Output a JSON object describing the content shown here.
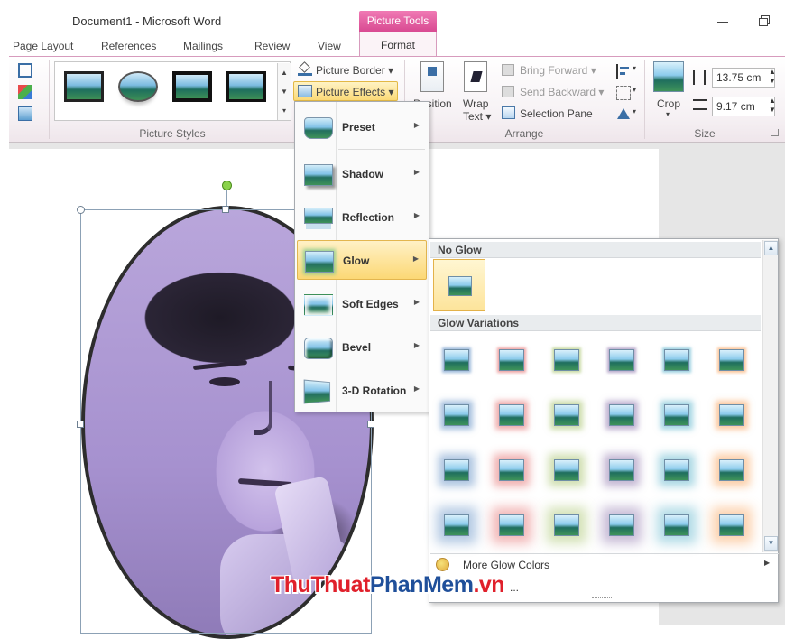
{
  "window": {
    "title": "Document1  -  Microsoft Word",
    "contextual_tab_group": "Picture Tools"
  },
  "tabs": [
    {
      "label": "Page Layout"
    },
    {
      "label": "References"
    },
    {
      "label": "Mailings"
    },
    {
      "label": "Review"
    },
    {
      "label": "View"
    },
    {
      "label": "Format",
      "active": true
    }
  ],
  "ribbon": {
    "picture_border": "Picture Border",
    "picture_effects": "Picture Effects",
    "picture_styles_label": "Picture Styles",
    "position": "Position",
    "wrap_text_line1": "Wrap",
    "wrap_text_line2": "Text",
    "bring_forward": "Bring Forward",
    "send_backward": "Send Backward",
    "selection_pane": "Selection Pane",
    "arrange_label": "Arrange",
    "crop": "Crop",
    "height": "13.75 cm",
    "width": "9.17 cm",
    "size_label": "Size"
  },
  "effects_menu": {
    "items": [
      {
        "label": "Preset"
      },
      {
        "label": "Shadow"
      },
      {
        "label": "Reflection"
      },
      {
        "label": "Glow",
        "selected": true
      },
      {
        "label": "Soft Edges"
      },
      {
        "label": "Bevel"
      },
      {
        "label": "3-D Rotation"
      }
    ]
  },
  "glow_panel": {
    "no_glow_header": "No Glow",
    "variations_header": "Glow Variations",
    "more_colors": "More Glow Colors",
    "options_partial": "...",
    "colors": [
      "#4f81bd",
      "#e05a5a",
      "#9bbb59",
      "#8064a2",
      "#4bacc6",
      "#f79646"
    ],
    "rows": 4
  },
  "watermark": {
    "part1": "ThuThuat",
    "part2": "PhanMem",
    "part3": ".vn"
  }
}
